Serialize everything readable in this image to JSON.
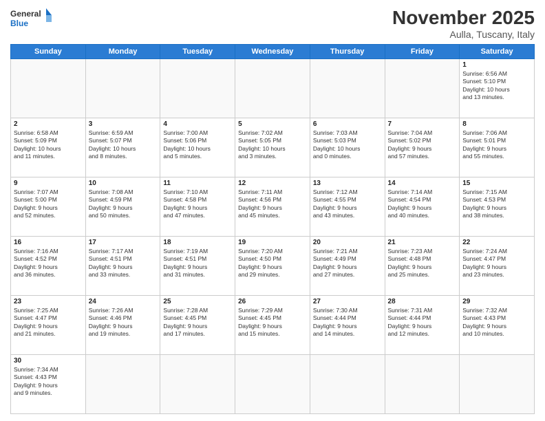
{
  "header": {
    "logo_general": "General",
    "logo_blue": "Blue",
    "month_title": "November 2025",
    "location": "Aulla, Tuscany, Italy"
  },
  "weekdays": [
    "Sunday",
    "Monday",
    "Tuesday",
    "Wednesday",
    "Thursday",
    "Friday",
    "Saturday"
  ],
  "weeks": [
    [
      {
        "day": "",
        "info": ""
      },
      {
        "day": "",
        "info": ""
      },
      {
        "day": "",
        "info": ""
      },
      {
        "day": "",
        "info": ""
      },
      {
        "day": "",
        "info": ""
      },
      {
        "day": "",
        "info": ""
      },
      {
        "day": "1",
        "info": "Sunrise: 6:56 AM\nSunset: 5:10 PM\nDaylight: 10 hours\nand 13 minutes."
      }
    ],
    [
      {
        "day": "2",
        "info": "Sunrise: 6:58 AM\nSunset: 5:09 PM\nDaylight: 10 hours\nand 11 minutes."
      },
      {
        "day": "3",
        "info": "Sunrise: 6:59 AM\nSunset: 5:07 PM\nDaylight: 10 hours\nand 8 minutes."
      },
      {
        "day": "4",
        "info": "Sunrise: 7:00 AM\nSunset: 5:06 PM\nDaylight: 10 hours\nand 5 minutes."
      },
      {
        "day": "5",
        "info": "Sunrise: 7:02 AM\nSunset: 5:05 PM\nDaylight: 10 hours\nand 3 minutes."
      },
      {
        "day": "6",
        "info": "Sunrise: 7:03 AM\nSunset: 5:03 PM\nDaylight: 10 hours\nand 0 minutes."
      },
      {
        "day": "7",
        "info": "Sunrise: 7:04 AM\nSunset: 5:02 PM\nDaylight: 9 hours\nand 57 minutes."
      },
      {
        "day": "8",
        "info": "Sunrise: 7:06 AM\nSunset: 5:01 PM\nDaylight: 9 hours\nand 55 minutes."
      }
    ],
    [
      {
        "day": "9",
        "info": "Sunrise: 7:07 AM\nSunset: 5:00 PM\nDaylight: 9 hours\nand 52 minutes."
      },
      {
        "day": "10",
        "info": "Sunrise: 7:08 AM\nSunset: 4:59 PM\nDaylight: 9 hours\nand 50 minutes."
      },
      {
        "day": "11",
        "info": "Sunrise: 7:10 AM\nSunset: 4:58 PM\nDaylight: 9 hours\nand 47 minutes."
      },
      {
        "day": "12",
        "info": "Sunrise: 7:11 AM\nSunset: 4:56 PM\nDaylight: 9 hours\nand 45 minutes."
      },
      {
        "day": "13",
        "info": "Sunrise: 7:12 AM\nSunset: 4:55 PM\nDaylight: 9 hours\nand 43 minutes."
      },
      {
        "day": "14",
        "info": "Sunrise: 7:14 AM\nSunset: 4:54 PM\nDaylight: 9 hours\nand 40 minutes."
      },
      {
        "day": "15",
        "info": "Sunrise: 7:15 AM\nSunset: 4:53 PM\nDaylight: 9 hours\nand 38 minutes."
      }
    ],
    [
      {
        "day": "16",
        "info": "Sunrise: 7:16 AM\nSunset: 4:52 PM\nDaylight: 9 hours\nand 36 minutes."
      },
      {
        "day": "17",
        "info": "Sunrise: 7:17 AM\nSunset: 4:51 PM\nDaylight: 9 hours\nand 33 minutes."
      },
      {
        "day": "18",
        "info": "Sunrise: 7:19 AM\nSunset: 4:51 PM\nDaylight: 9 hours\nand 31 minutes."
      },
      {
        "day": "19",
        "info": "Sunrise: 7:20 AM\nSunset: 4:50 PM\nDaylight: 9 hours\nand 29 minutes."
      },
      {
        "day": "20",
        "info": "Sunrise: 7:21 AM\nSunset: 4:49 PM\nDaylight: 9 hours\nand 27 minutes."
      },
      {
        "day": "21",
        "info": "Sunrise: 7:23 AM\nSunset: 4:48 PM\nDaylight: 9 hours\nand 25 minutes."
      },
      {
        "day": "22",
        "info": "Sunrise: 7:24 AM\nSunset: 4:47 PM\nDaylight: 9 hours\nand 23 minutes."
      }
    ],
    [
      {
        "day": "23",
        "info": "Sunrise: 7:25 AM\nSunset: 4:47 PM\nDaylight: 9 hours\nand 21 minutes."
      },
      {
        "day": "24",
        "info": "Sunrise: 7:26 AM\nSunset: 4:46 PM\nDaylight: 9 hours\nand 19 minutes."
      },
      {
        "day": "25",
        "info": "Sunrise: 7:28 AM\nSunset: 4:45 PM\nDaylight: 9 hours\nand 17 minutes."
      },
      {
        "day": "26",
        "info": "Sunrise: 7:29 AM\nSunset: 4:45 PM\nDaylight: 9 hours\nand 15 minutes."
      },
      {
        "day": "27",
        "info": "Sunrise: 7:30 AM\nSunset: 4:44 PM\nDaylight: 9 hours\nand 14 minutes."
      },
      {
        "day": "28",
        "info": "Sunrise: 7:31 AM\nSunset: 4:44 PM\nDaylight: 9 hours\nand 12 minutes."
      },
      {
        "day": "29",
        "info": "Sunrise: 7:32 AM\nSunset: 4:43 PM\nDaylight: 9 hours\nand 10 minutes."
      }
    ],
    [
      {
        "day": "30",
        "info": "Sunrise: 7:34 AM\nSunset: 4:43 PM\nDaylight: 9 hours\nand 9 minutes."
      },
      {
        "day": "",
        "info": ""
      },
      {
        "day": "",
        "info": ""
      },
      {
        "day": "",
        "info": ""
      },
      {
        "day": "",
        "info": ""
      },
      {
        "day": "",
        "info": ""
      },
      {
        "day": "",
        "info": ""
      }
    ]
  ]
}
